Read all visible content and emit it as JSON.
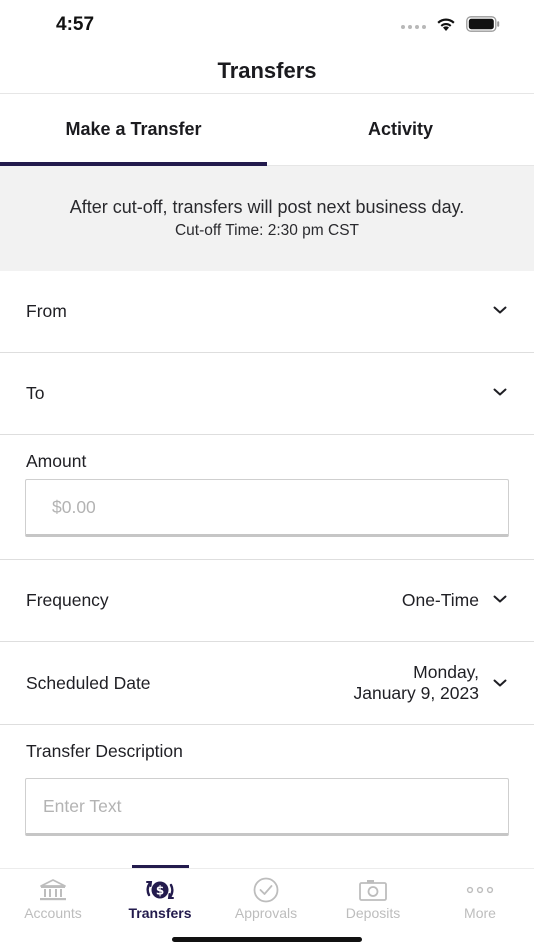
{
  "status_bar": {
    "time": "4:57",
    "icons": [
      "signal-dots-icon",
      "wifi-icon",
      "battery-icon"
    ]
  },
  "header": {
    "title": "Transfers"
  },
  "tabs": [
    {
      "label": "Make a Transfer",
      "selected": true
    },
    {
      "label": "Activity",
      "selected": false
    }
  ],
  "notice": {
    "message": "After cut-off, transfers will post next business day.",
    "cutoff": "Cut-off Time: 2:30 pm CST"
  },
  "form": {
    "from_label": "From",
    "to_label": "To",
    "amount_label": "Amount",
    "amount_placeholder": "$0.00",
    "amount_value": "",
    "frequency_label": "Frequency",
    "frequency_value": "One-Time",
    "scheduled_date_label": "Scheduled Date",
    "scheduled_date_line1": "Monday,",
    "scheduled_date_line2": "January 9, 2023",
    "description_label": "Transfer Description",
    "description_placeholder": "Enter Text",
    "description_value": ""
  },
  "bottom_nav": [
    {
      "label": "Accounts",
      "icon": "bank-icon",
      "active": false
    },
    {
      "label": "Transfers",
      "icon": "transfer-dollar-icon",
      "active": true
    },
    {
      "label": "Approvals",
      "icon": "check-circle-icon",
      "active": false
    },
    {
      "label": "Deposits",
      "icon": "camera-icon",
      "active": false
    },
    {
      "label": "More",
      "icon": "more-dots-icon",
      "active": false
    }
  ],
  "colors": {
    "accent": "#231b4d",
    "notice_bg": "#f2f2f2",
    "inactive": "#bdbdbd"
  }
}
